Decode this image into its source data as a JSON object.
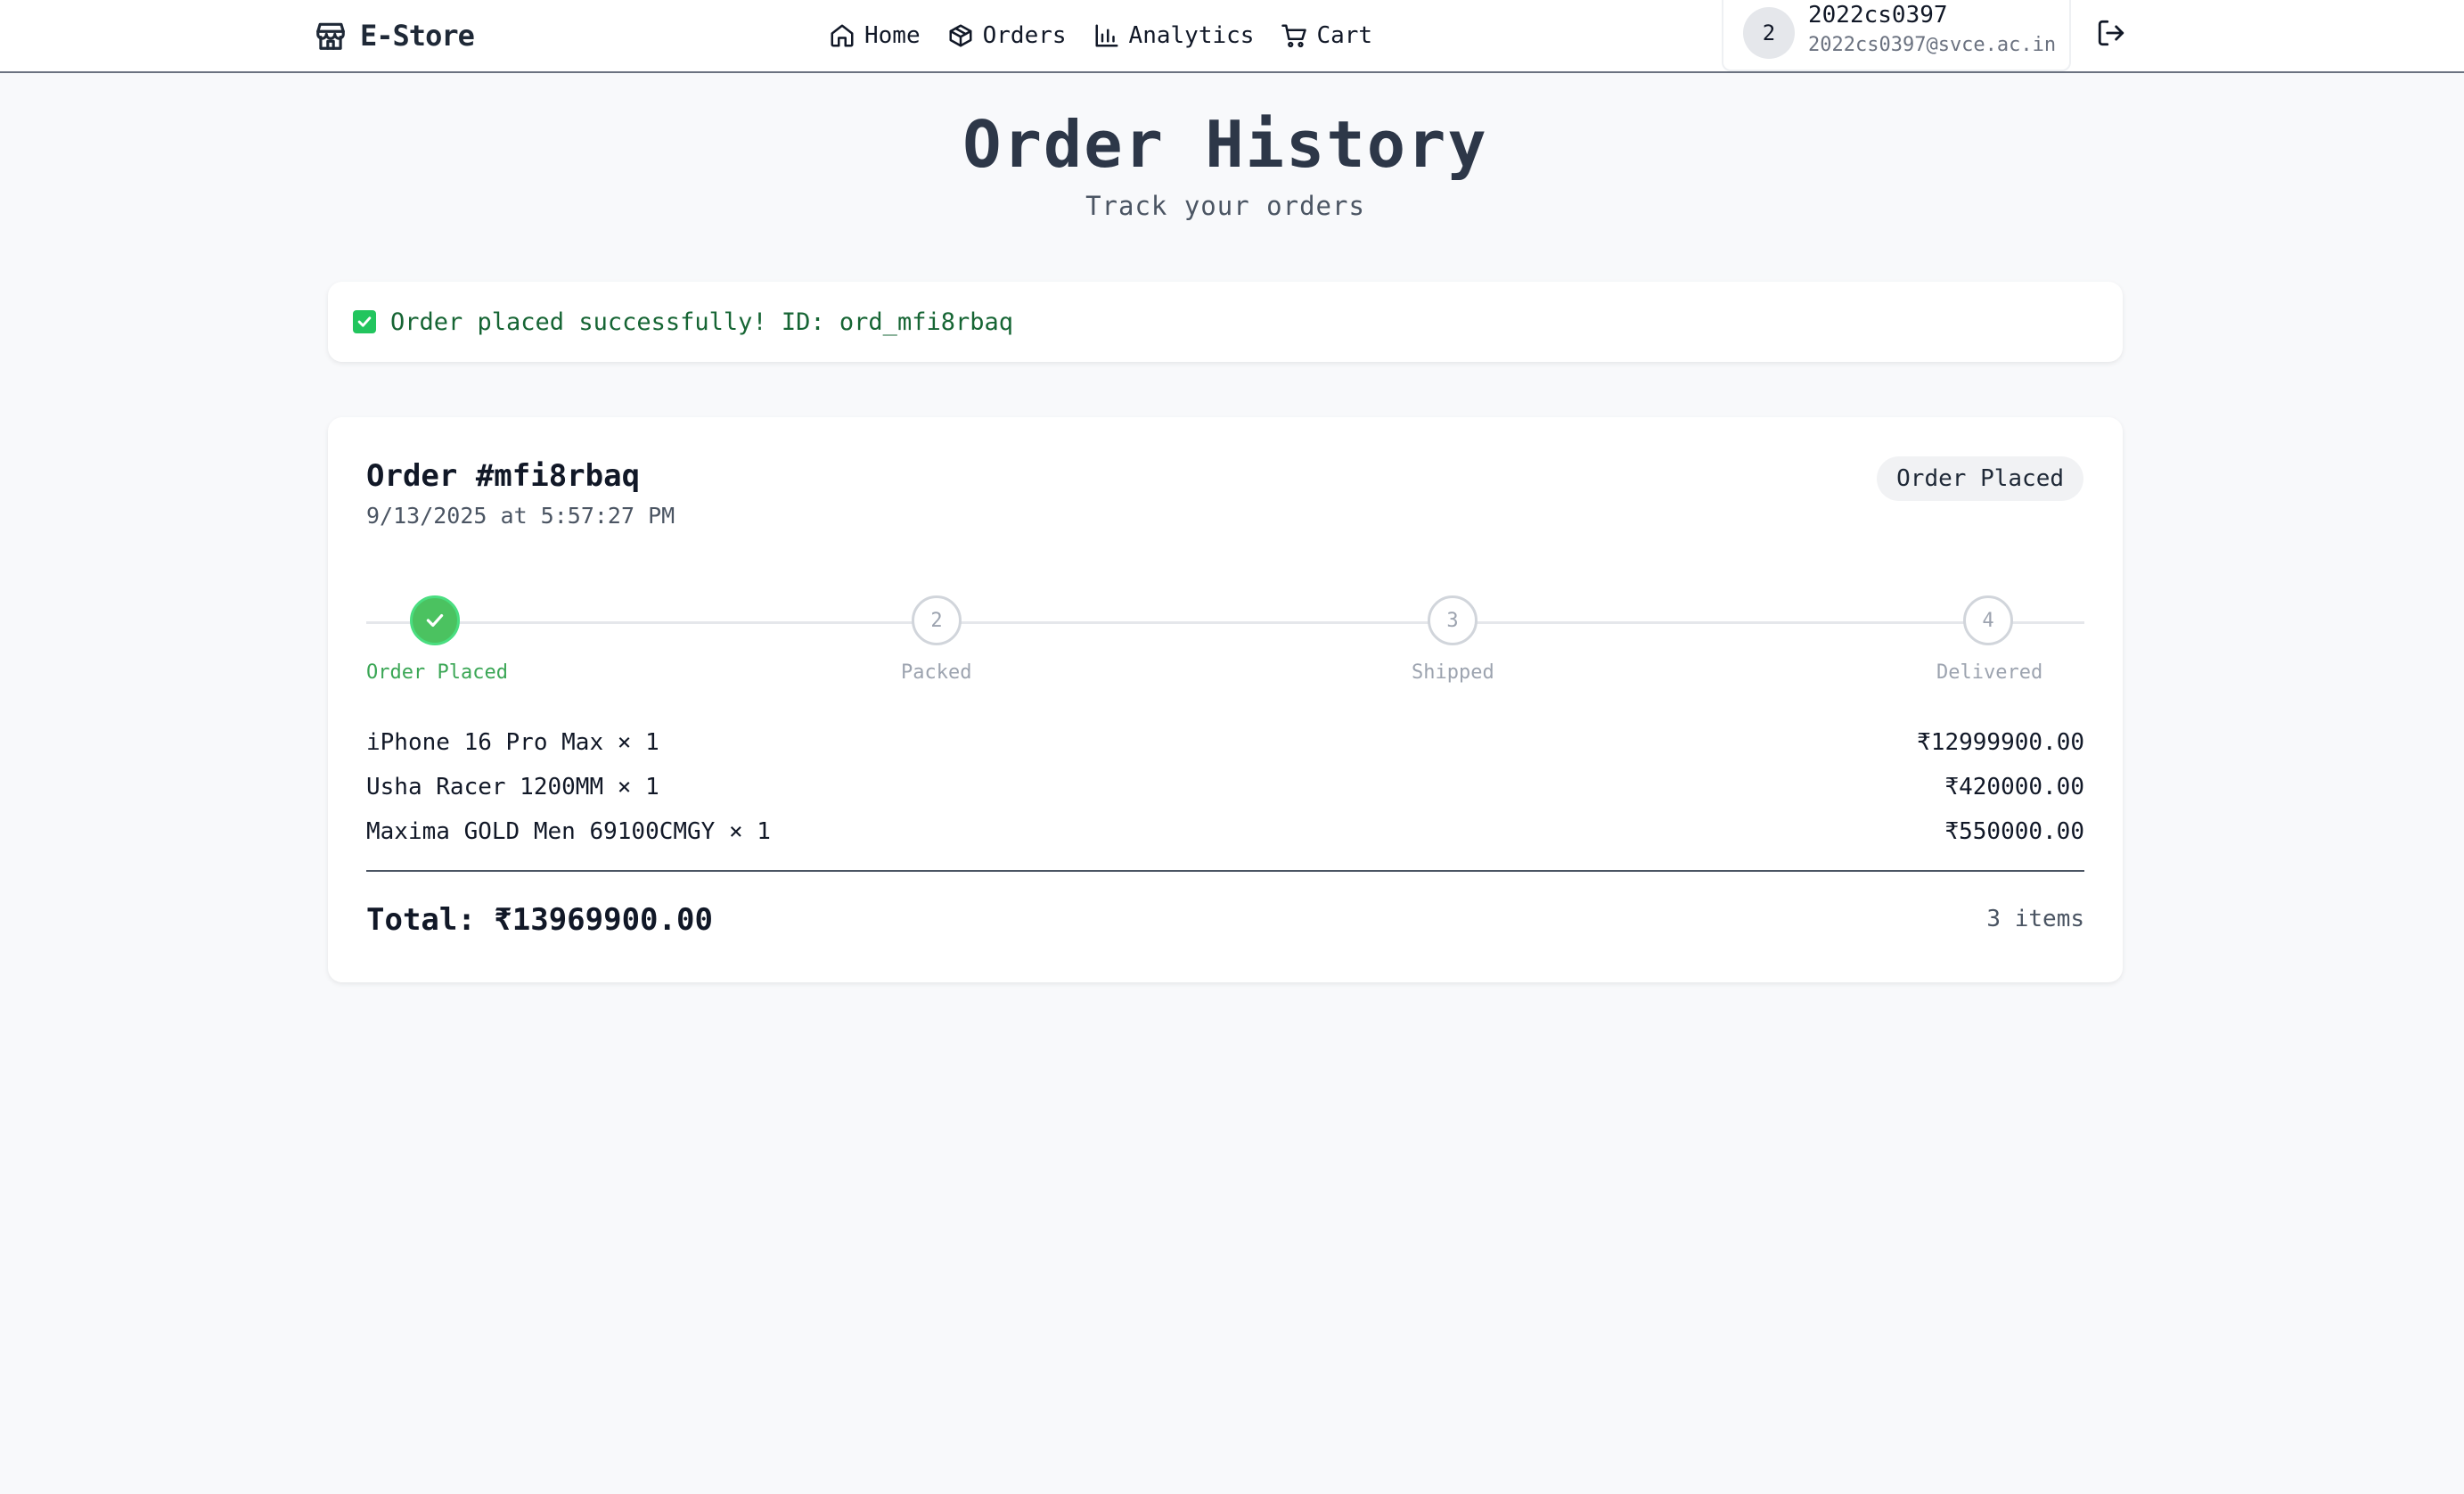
{
  "brand": {
    "name": "E-Store",
    "icon": "store-icon"
  },
  "nav": [
    {
      "label": "Home",
      "icon": "home-icon"
    },
    {
      "label": "Orders",
      "icon": "box-icon"
    },
    {
      "label": "Analytics",
      "icon": "bar-chart-icon"
    },
    {
      "label": "Cart",
      "icon": "cart-icon"
    }
  ],
  "user": {
    "avatar_initial": "2",
    "username": "2022cs0397",
    "email": "2022cs0397@svce.ac.in"
  },
  "page": {
    "title": "Order History",
    "subtitle": "Track your orders"
  },
  "banner": {
    "text": "Order placed successfully! ID: ord_mfi8rbaq",
    "color": "#166534"
  },
  "order": {
    "title": "Order #mfi8rbaq",
    "date": "9/13/2025 at 5:57:27 PM",
    "status": "Order Placed",
    "steps": [
      {
        "number": "1",
        "label": "Order Placed",
        "done": true
      },
      {
        "number": "2",
        "label": "Packed",
        "done": false
      },
      {
        "number": "3",
        "label": "Shipped",
        "done": false
      },
      {
        "number": "4",
        "label": "Delivered",
        "done": false
      }
    ],
    "items": [
      {
        "name": "iPhone 16 Pro Max × 1",
        "price": "₹12999900.00"
      },
      {
        "name": "Usha Racer 1200MM × 1",
        "price": "₹420000.00"
      },
      {
        "name": "Maxima GOLD Men 69100CMGY × 1",
        "price": "₹550000.00"
      }
    ],
    "total": "Total: ₹13969900.00",
    "item_count": "3 items"
  },
  "colors": {
    "accent_green": "#4bc260",
    "background": "#f8f9fb"
  }
}
